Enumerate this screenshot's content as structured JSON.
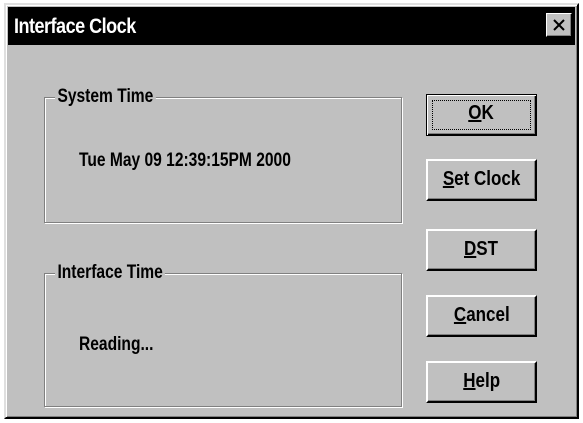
{
  "window": {
    "title": "Interface Clock",
    "close_symbol": "X"
  },
  "system_time": {
    "legend": "System Time",
    "value": "Tue May 09 12:39:15PM 2000"
  },
  "interface_time": {
    "legend": "Interface Time",
    "value": "Reading..."
  },
  "buttons": {
    "ok": {
      "mnemonic": "O",
      "rest": "K"
    },
    "set_clock": {
      "mnemonic": "S",
      "rest": "et Clock"
    },
    "dst": {
      "mnemonic": "D",
      "rest": "ST"
    },
    "cancel": {
      "mnemonic": "C",
      "rest": "ancel"
    },
    "help": {
      "mnemonic": "H",
      "rest": "elp"
    }
  }
}
